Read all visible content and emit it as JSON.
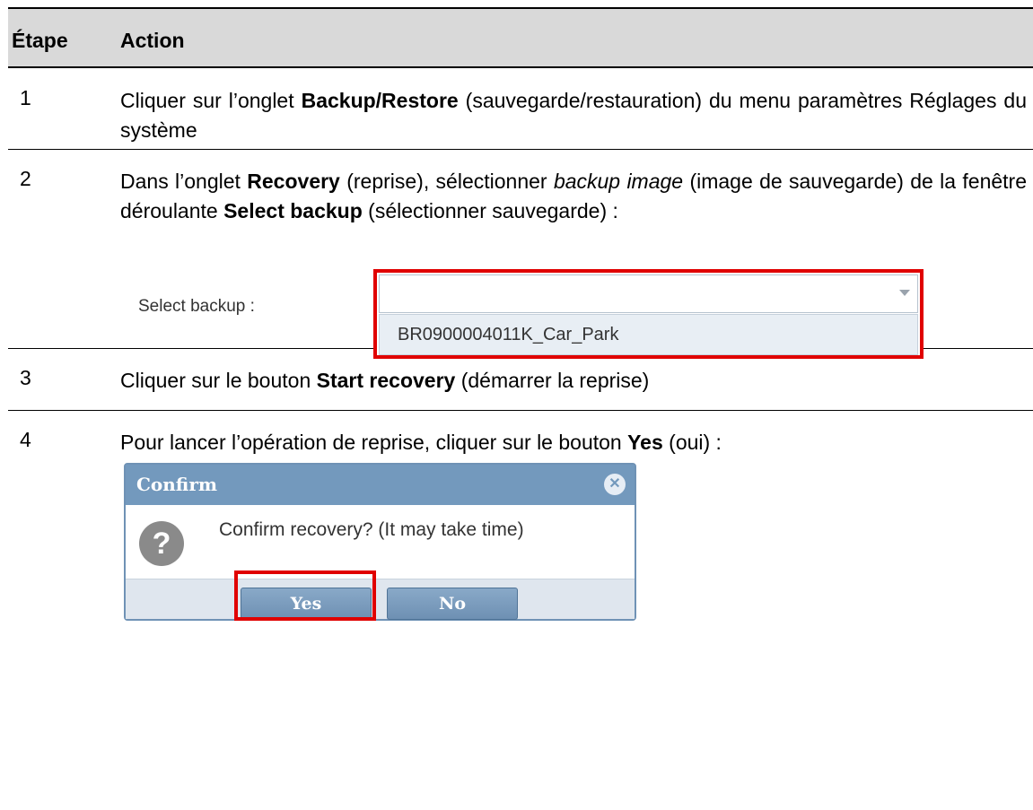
{
  "table": {
    "header": {
      "col_step": "Étape",
      "col_action": "Action"
    },
    "rows": [
      {
        "step": "1",
        "t1": "Cliquer sur l’onglet ",
        "b1": "Backup/Restore",
        "t2": " (sauvegarde/restauration) du menu paramètres Réglages du système"
      },
      {
        "step": "2",
        "t1": "Dans l’onglet ",
        "b1": "Recovery",
        "t2": " (reprise), sélectionner ",
        "i1": "backup image",
        "t3": " (image de sauvegarde) de la fenêtre déroulante ",
        "b2": "Select backup",
        "t4": " (sélectionner sauvegarde) :"
      },
      {
        "step": "3",
        "t1": "Cliquer sur le bouton ",
        "b1": "Start recovery",
        "t2": " (démarrer la reprise)"
      },
      {
        "step": "4",
        "t1": "Pour lancer l’opération de reprise, cliquer sur le bouton ",
        "b1": "Yes",
        "t2": " (oui) :"
      }
    ]
  },
  "select_backup": {
    "label": "Select backup :",
    "value": "",
    "option": "BR0900004011K_Car_Park",
    "highlight_color": "#e00000"
  },
  "confirm_dialog": {
    "title": "Confirm",
    "message": "Confirm recovery? (It may take time)",
    "question_glyph": "?",
    "close_glyph": "✕",
    "yes_label": "Yes",
    "no_label": "No",
    "header_color": "#7399bd",
    "highlight_color": "#e00000"
  }
}
